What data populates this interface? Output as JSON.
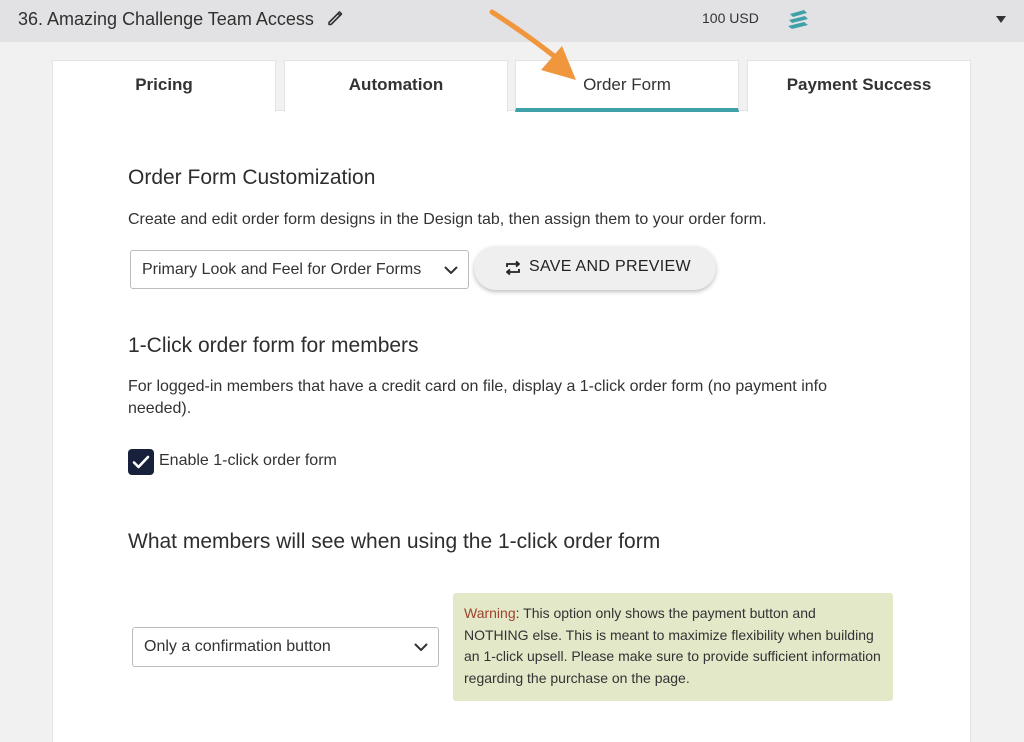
{
  "header": {
    "title": "36.  Amazing Challenge Team Access",
    "price": "100 USD"
  },
  "tabs": [
    {
      "label": "Pricing",
      "active": false
    },
    {
      "label": "Automation",
      "active": false
    },
    {
      "label": "Order Form",
      "active": true
    },
    {
      "label": "Payment Success",
      "active": false
    }
  ],
  "customization": {
    "heading": "Order Form Customization",
    "description": "Create and edit order form designs in the Design tab, then assign them to your order form.",
    "design_select": "Primary Look and Feel for Order Forms",
    "save_button": "SAVE AND PREVIEW"
  },
  "one_click": {
    "heading": "1-Click order form for members",
    "description": "For logged-in members that have a credit card on file, display a 1-click order form (no payment info needed).",
    "checkbox_label": "Enable 1-click order form",
    "checked": true
  },
  "member_view": {
    "heading": "What members will see when using the 1-click order form",
    "select_value": "Only a confirmation button",
    "warning_label": "Warning",
    "warning_text": ": This option only shows the payment button and NOTHING else. This is meant to maximize flexibility when building an 1-click upsell. Please make sure to provide sufficient information regarding the purchase on the page."
  },
  "colors": {
    "accent_tab": "#3fa1a8",
    "arrow": "#f0963c",
    "checkbox": "#17213b",
    "warning_bg": "#e3e8c9",
    "warning_label": "#a0422c",
    "stack_icon": "#3fa1a8"
  },
  "icons": [
    "pencil-icon",
    "stack-icon",
    "collapse-triangle-icon",
    "chevron-down-icon",
    "repeat-icon",
    "check-icon",
    "arrow-pointer"
  ]
}
